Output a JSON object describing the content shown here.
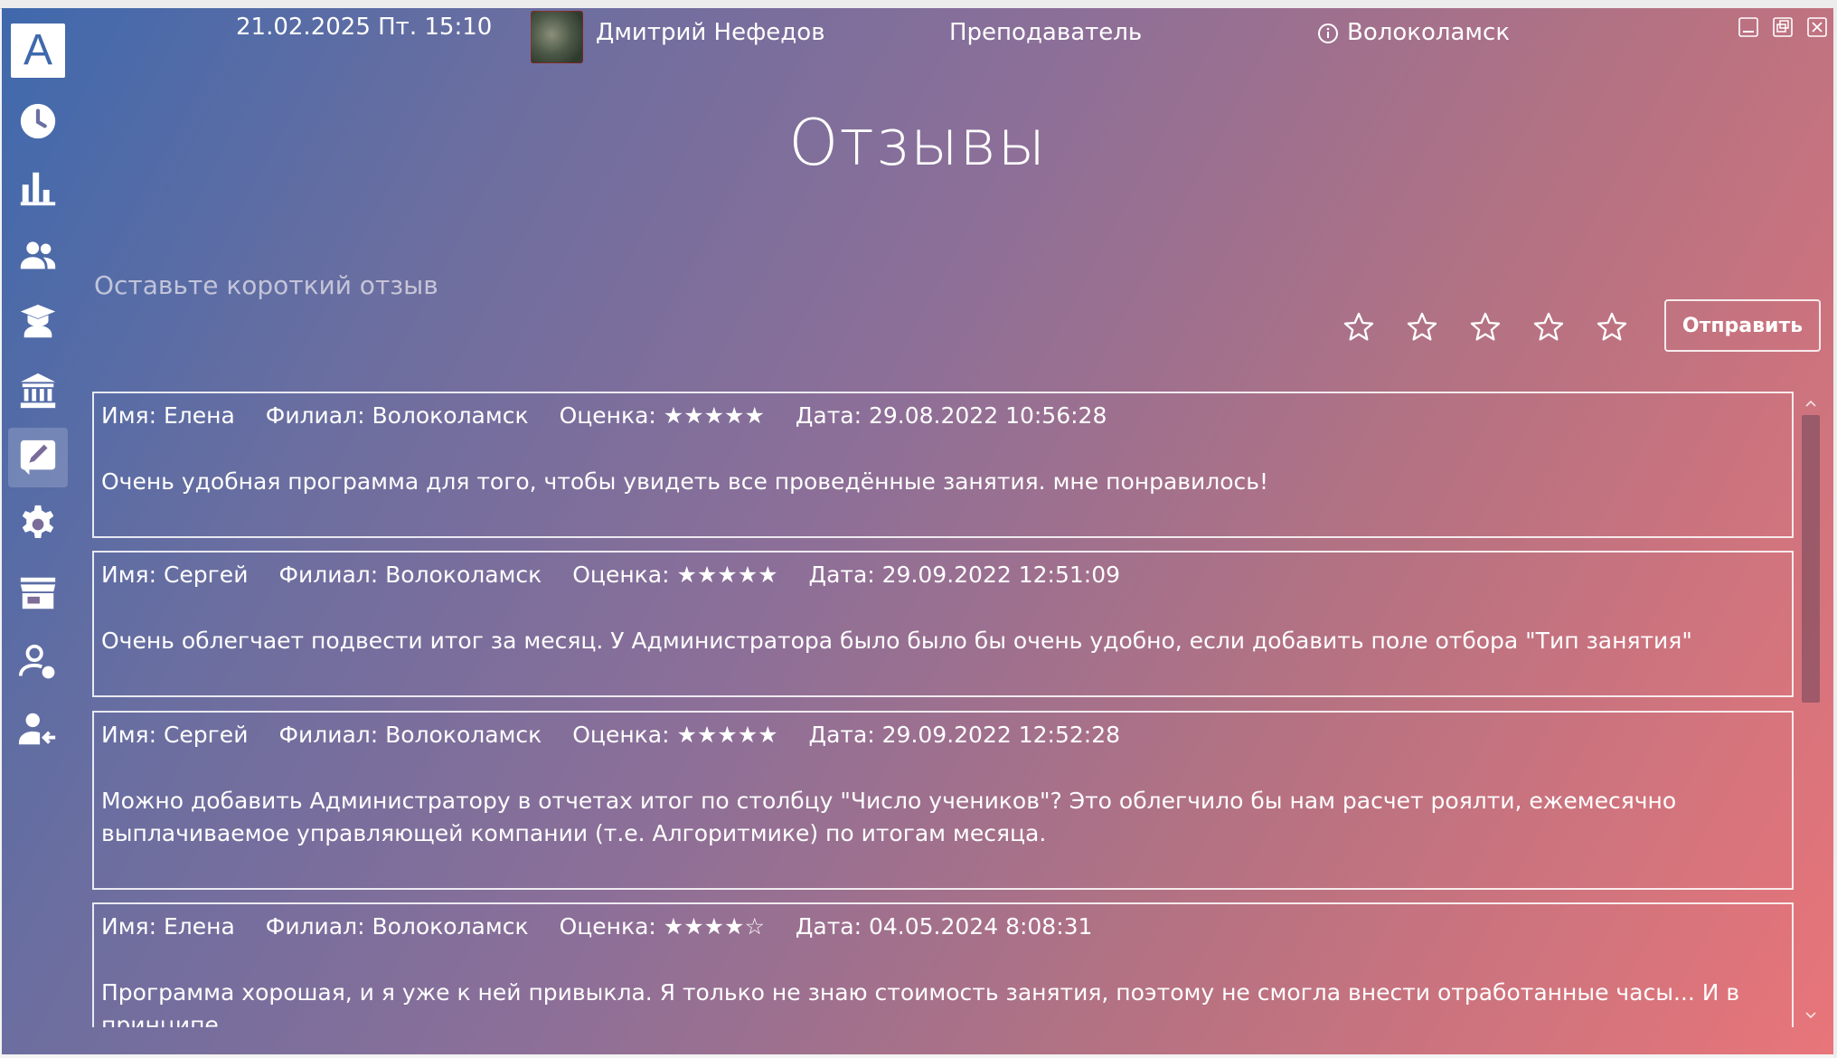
{
  "header": {
    "datetime": "21.02.2025 Пт. 15:10",
    "user_name": "Дмитрий Нефедов",
    "role": "Преподаватель",
    "branch": "Волоколамск"
  },
  "logo": {
    "letter": "A"
  },
  "sidebar": {
    "items": [
      {
        "icon": "clock-icon"
      },
      {
        "icon": "bar-chart-icon"
      },
      {
        "icon": "people-icon"
      },
      {
        "icon": "graduate-icon"
      },
      {
        "icon": "institution-icon"
      },
      {
        "icon": "edit-icon",
        "active": true
      },
      {
        "icon": "gear-icon"
      },
      {
        "icon": "store-icon"
      },
      {
        "icon": "user-status-icon"
      },
      {
        "icon": "user-logout-icon"
      }
    ]
  },
  "page": {
    "title": "Отзывы"
  },
  "feedback": {
    "placeholder": "Оставьте короткий отзыв",
    "rating": 0,
    "max_rating": 5,
    "send_label": "Отправить"
  },
  "reviews": [
    {
      "name": "Имя: Елена",
      "branch": "Филиал: Волоколамск",
      "rating": "Оценка: ★★★★★",
      "date": "Дата: 29.08.2022 10:56:28",
      "text": "Очень удобная программа для того, чтобы увидеть все проведённые занятия. мне понравилось!"
    },
    {
      "name": "Имя: Сергей",
      "branch": "Филиал: Волоколамск",
      "rating": "Оценка: ★★★★★",
      "date": "Дата: 29.09.2022 12:51:09",
      "text": "Очень облегчает подвести итог за месяц. У Администратора было было бы очень удобно, если добавить поле отбора \"Тип занятия\""
    },
    {
      "name": "Имя: Сергей",
      "branch": "Филиал: Волоколамск",
      "rating": "Оценка: ★★★★★",
      "date": "Дата: 29.09.2022 12:52:28",
      "text": "Можно добавить Администратору в отчетах итог по столбцу \"Число учеников\"? Это облегчило бы нам расчет роялти, ежемесячно выплачиваемое управляющей компании (т.е. Алгоритмике) по итогам месяца."
    },
    {
      "name": "Имя: Елена",
      "branch": "Филиал: Волоколамск",
      "rating": "Оценка: ★★★★☆",
      "date": "Дата: 04.05.2024 8:08:31",
      "text": "Программа хорошая, и я уже к ней привыкла.  Я только не знаю стоимость занятия, поэтому не смогла внести отработанные часы... И в принципе,"
    }
  ],
  "colors": {
    "gradient_start": "#3f69ad",
    "gradient_end": "#e87579",
    "text": "#ffffff"
  }
}
